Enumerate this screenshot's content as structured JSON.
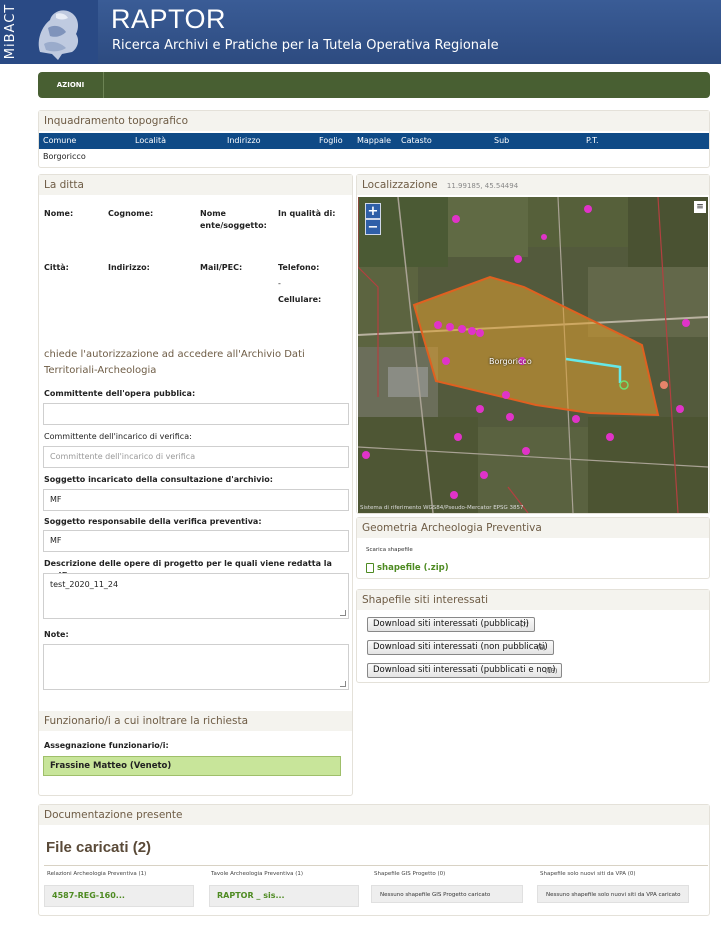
{
  "header": {
    "brand_vertical": "MiBACT",
    "title": "RAPTOR",
    "subtitle": "Ricerca Archivi e Pratiche per la Tutela Operativa Regionale"
  },
  "actionbar": {
    "actions_label": "AZIONI"
  },
  "topo": {
    "title": "Inquadramento topografico",
    "columns": [
      "Comune",
      "Località",
      "Indirizzo",
      "Foglio",
      "Mappale",
      "Catasto",
      "Sub",
      "P.T."
    ],
    "row": {
      "comune": "Borgoricco"
    }
  },
  "ditta": {
    "title": "La ditta",
    "labels": {
      "nome": "Nome:",
      "cognome": "Cognome:",
      "ente": "Nome ente/soggetto:",
      "qualita": "In qualità di:",
      "citta": "Città:",
      "indirizzo": "Indirizzo:",
      "mail": "Mail/PEC:",
      "telefono": "Telefono:",
      "dash": "-",
      "cellulare": "Cellulare:"
    }
  },
  "request": {
    "heading": "chiede l'autorizzazione ad accedere all'Archivio Dati Territoriali-Archeologia",
    "committente_opera_label": "Committente dell'opera pubblica:",
    "committente_opera_value": "",
    "committente_incarico_label": "Committente dell'incarico di verifica:",
    "committente_incarico_placeholder": "Committente dell'incarico di verifica",
    "soggetto_incaricato_label": "Soggetto incaricato della consultazione d'archivio:",
    "soggetto_incaricato_value": "MF",
    "soggetto_responsabile_label": "Soggetto responsabile della verifica preventiva:",
    "soggetto_responsabile_value": "MF",
    "descrizione_label": "Descrizione delle opere di progetto per le quali viene redatta la verifica:",
    "descrizione_value": "test_2020_11_24",
    "note_label": "Note:",
    "note_value": ""
  },
  "funzionari": {
    "title": "Funzionario/i a cui inoltrare la richiesta",
    "label": "Assegnazione funzionario/i:",
    "selected": "Frassine Matteo (Veneto)"
  },
  "map": {
    "title": "Localizzazione",
    "coords": "11.99185, 45.54494",
    "zoom_in": "+",
    "zoom_out": "−",
    "menu": "≡",
    "place_label": "Borgoricco",
    "attribution": "Sistema di riferimento WGS84/Pseudo-Mercator EPSG 3857"
  },
  "geometria": {
    "title": "Geometria Archeologia Preventiva",
    "scarica_label": "Scarica shapefile",
    "link_label": "shapefile (.zip)"
  },
  "shapefile": {
    "title": "Shapefile siti interessati",
    "buttons": [
      {
        "label": "Download siti interessati (pubblicati)",
        "count": "(7)"
      },
      {
        "label": "Download siti interessati (non pubblicati)",
        "count": "(6)"
      },
      {
        "label": "Download siti interessati (pubblicati e non)",
        "count": "(13)"
      }
    ]
  },
  "documentazione": {
    "title": "Documentazione presente",
    "files_title": "File caricati (2)",
    "columns": [
      {
        "header": "Relazioni Archeologia Preventiva (1)",
        "value": "4587-REG-160..."
      },
      {
        "header": "Tavole Archeologia Preventiva (1)",
        "value": "RAPTOR _ sis..."
      },
      {
        "header": "Shapefile GIS Progetto (0)",
        "value": "Nessuno shapefile GIS Progetto caricato"
      },
      {
        "header": "Shapefile solo nuovi siti da VPA (0)",
        "value": "Nessuno shapefile solo nuovi siti da VPA caricato"
      }
    ]
  },
  "colors": {
    "header_blue": "#2d4b80",
    "actionbar_green": "#485f32",
    "table_header_blue": "#0f4a86",
    "link_green": "#4e8b22",
    "select_green": "#c8e59a",
    "polygon_orange": "#e0a030",
    "site_magenta": "#e033c8"
  }
}
